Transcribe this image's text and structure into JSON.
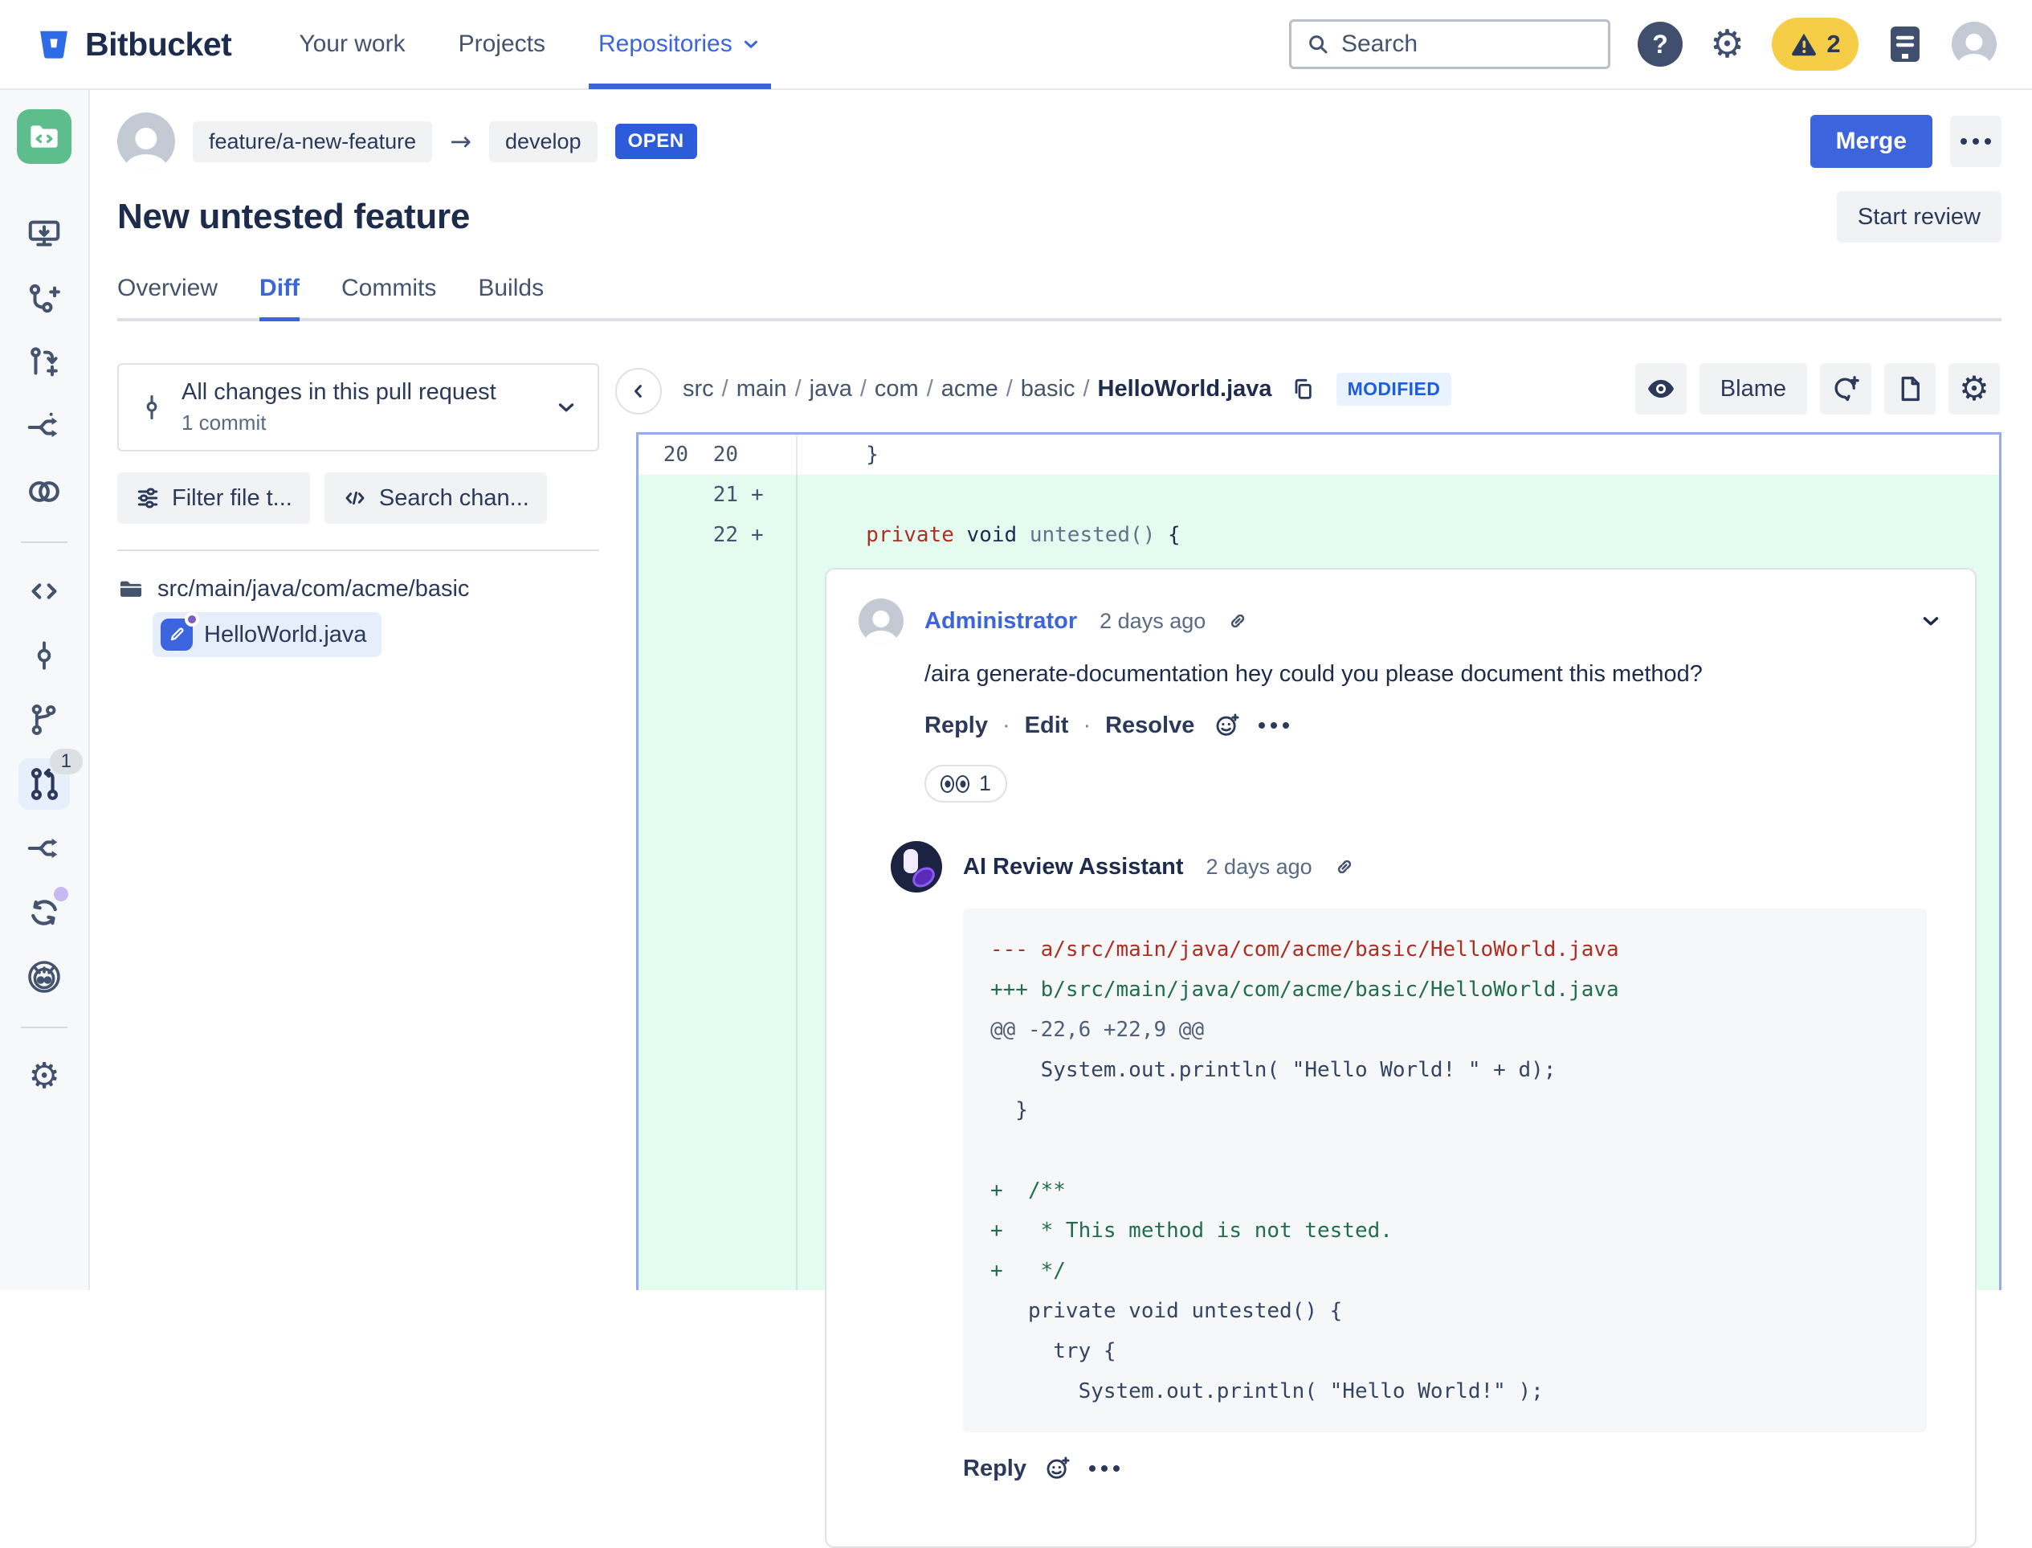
{
  "topnav": {
    "brand": "Bitbucket",
    "links": [
      {
        "label": "Your work"
      },
      {
        "label": "Projects"
      },
      {
        "label": "Repositories"
      }
    ],
    "active_link": "Repositories",
    "search_placeholder": "Search",
    "help_glyph": "?",
    "warning_count": "2"
  },
  "icons": {
    "gear": "⚙",
    "arrow_right": "→"
  },
  "pr": {
    "source_branch": "feature/a-new-feature",
    "target_branch": "develop",
    "status": "OPEN",
    "title": "New untested feature",
    "merge_label": "Merge",
    "start_review_label": "Start review",
    "tabs": [
      {
        "label": "Overview"
      },
      {
        "label": "Diff"
      },
      {
        "label": "Commits"
      },
      {
        "label": "Builds"
      }
    ],
    "active_tab": "Diff"
  },
  "left_panel": {
    "changes_title": "All changes in this pull request",
    "changes_subtitle": "1 commit",
    "filter_label": "Filter file t...",
    "search_label": "Search chan...",
    "folder": "src/main/java/com/acme/basic",
    "file": "HelloWorld.java"
  },
  "diff": {
    "breadcrumb": [
      "src",
      "main",
      "java",
      "com",
      "acme",
      "basic"
    ],
    "file": "HelloWorld.java",
    "badge": "MODIFIED",
    "blame_label": "Blame",
    "rows": [
      {
        "old": "20",
        "new": "20",
        "sign": "",
        "code": "  }"
      },
      {
        "old": "",
        "new": "21",
        "sign": "+",
        "code": ""
      },
      {
        "old": "",
        "new": "22",
        "sign": "+",
        "code": ""
      }
    ],
    "line22_tokens": {
      "kw": "  private",
      "type": " void",
      "name": " untested()",
      "brace": " {"
    }
  },
  "comment": {
    "author": "Administrator",
    "time": "2 days ago",
    "body": "/aira generate-documentation hey could you please document this method?",
    "actions": [
      {
        "label": "Reply"
      },
      {
        "label": "Edit"
      },
      {
        "label": "Resolve"
      }
    ],
    "reaction_count": "1"
  },
  "reply": {
    "author": "AI Review Assistant",
    "time": "2 days ago",
    "reply_label": "Reply",
    "code_lines": [
      {
        "type": "removed",
        "text": "--- a/src/main/java/com/acme/basic/HelloWorld.java"
      },
      {
        "type": "added",
        "text": "+++ b/src/main/java/com/acme/basic/HelloWorld.java"
      },
      {
        "type": "hunk",
        "text": "@@ -22,6 +22,9 @@"
      },
      {
        "type": "context",
        "text": "    System.out.println( \"Hello World! \" + d);"
      },
      {
        "type": "context",
        "text": "  }"
      },
      {
        "type": "blank",
        "text": ""
      },
      {
        "type": "added",
        "text": "+  /**"
      },
      {
        "type": "added",
        "text": "+   * This method is not tested."
      },
      {
        "type": "added",
        "text": "+   */"
      },
      {
        "type": "context",
        "text": "   private void untested() {"
      },
      {
        "type": "context",
        "text": "     try {"
      },
      {
        "type": "context",
        "text": "       System.out.println( \"Hello World!\" );"
      }
    ]
  }
}
